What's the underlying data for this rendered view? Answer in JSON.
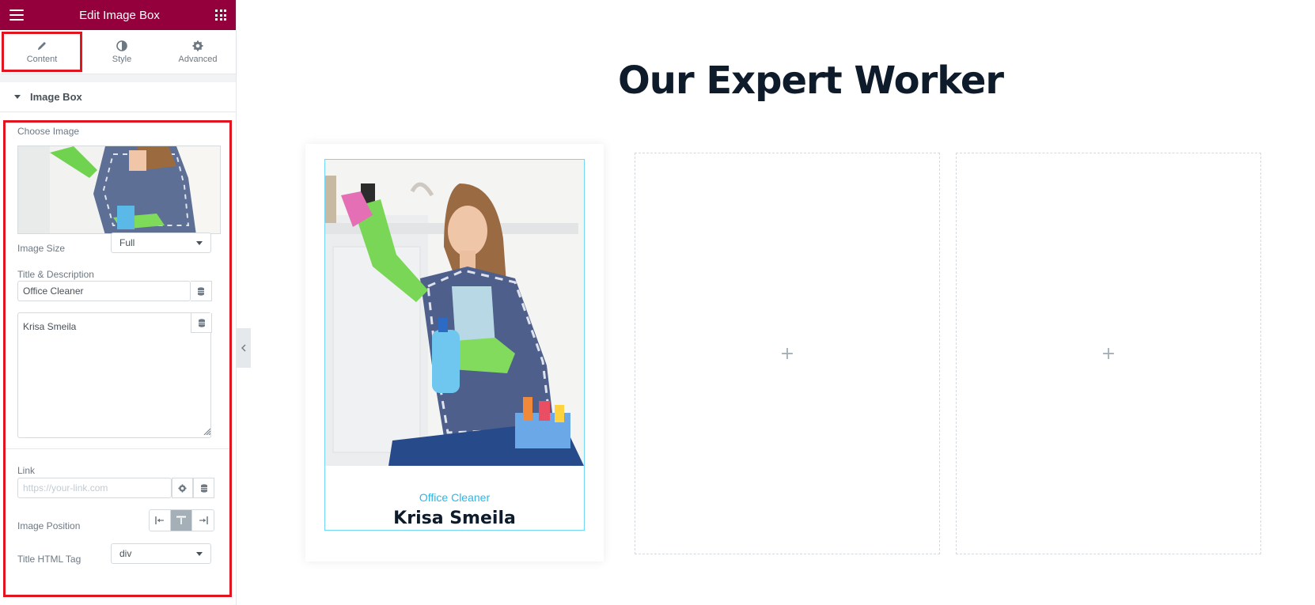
{
  "panel": {
    "title": "Edit Image Box",
    "tabs": [
      {
        "label": "Content",
        "icon": "pencil-icon",
        "active": true
      },
      {
        "label": "Style",
        "icon": "contrast-icon",
        "active": false
      },
      {
        "label": "Advanced",
        "icon": "gear-icon",
        "active": false
      }
    ],
    "section_title": "Image Box",
    "controls": {
      "choose_image_label": "Choose Image",
      "image_size_label": "Image Size",
      "image_size_value": "Full",
      "title_desc_label": "Title & Description",
      "title_value": "Office Cleaner",
      "description_value": "Krisa Smeila",
      "link_label": "Link",
      "link_placeholder": "https://your-link.com",
      "image_position_label": "Image Position",
      "image_position_options": [
        "left",
        "top",
        "right"
      ],
      "image_position_selected": "top",
      "title_html_tag_label": "Title HTML Tag",
      "title_html_tag_value": "div"
    }
  },
  "canvas": {
    "heading": "Our Expert Worker",
    "card": {
      "title": "Office Cleaner",
      "name": "Krisa Smeila"
    },
    "empty_columns": [
      "+",
      "+"
    ]
  },
  "colors": {
    "header_bg": "#93003c",
    "highlight": "#e0151f",
    "accent_text": "#2ab7e8",
    "heading_text": "#0e1b2b"
  }
}
